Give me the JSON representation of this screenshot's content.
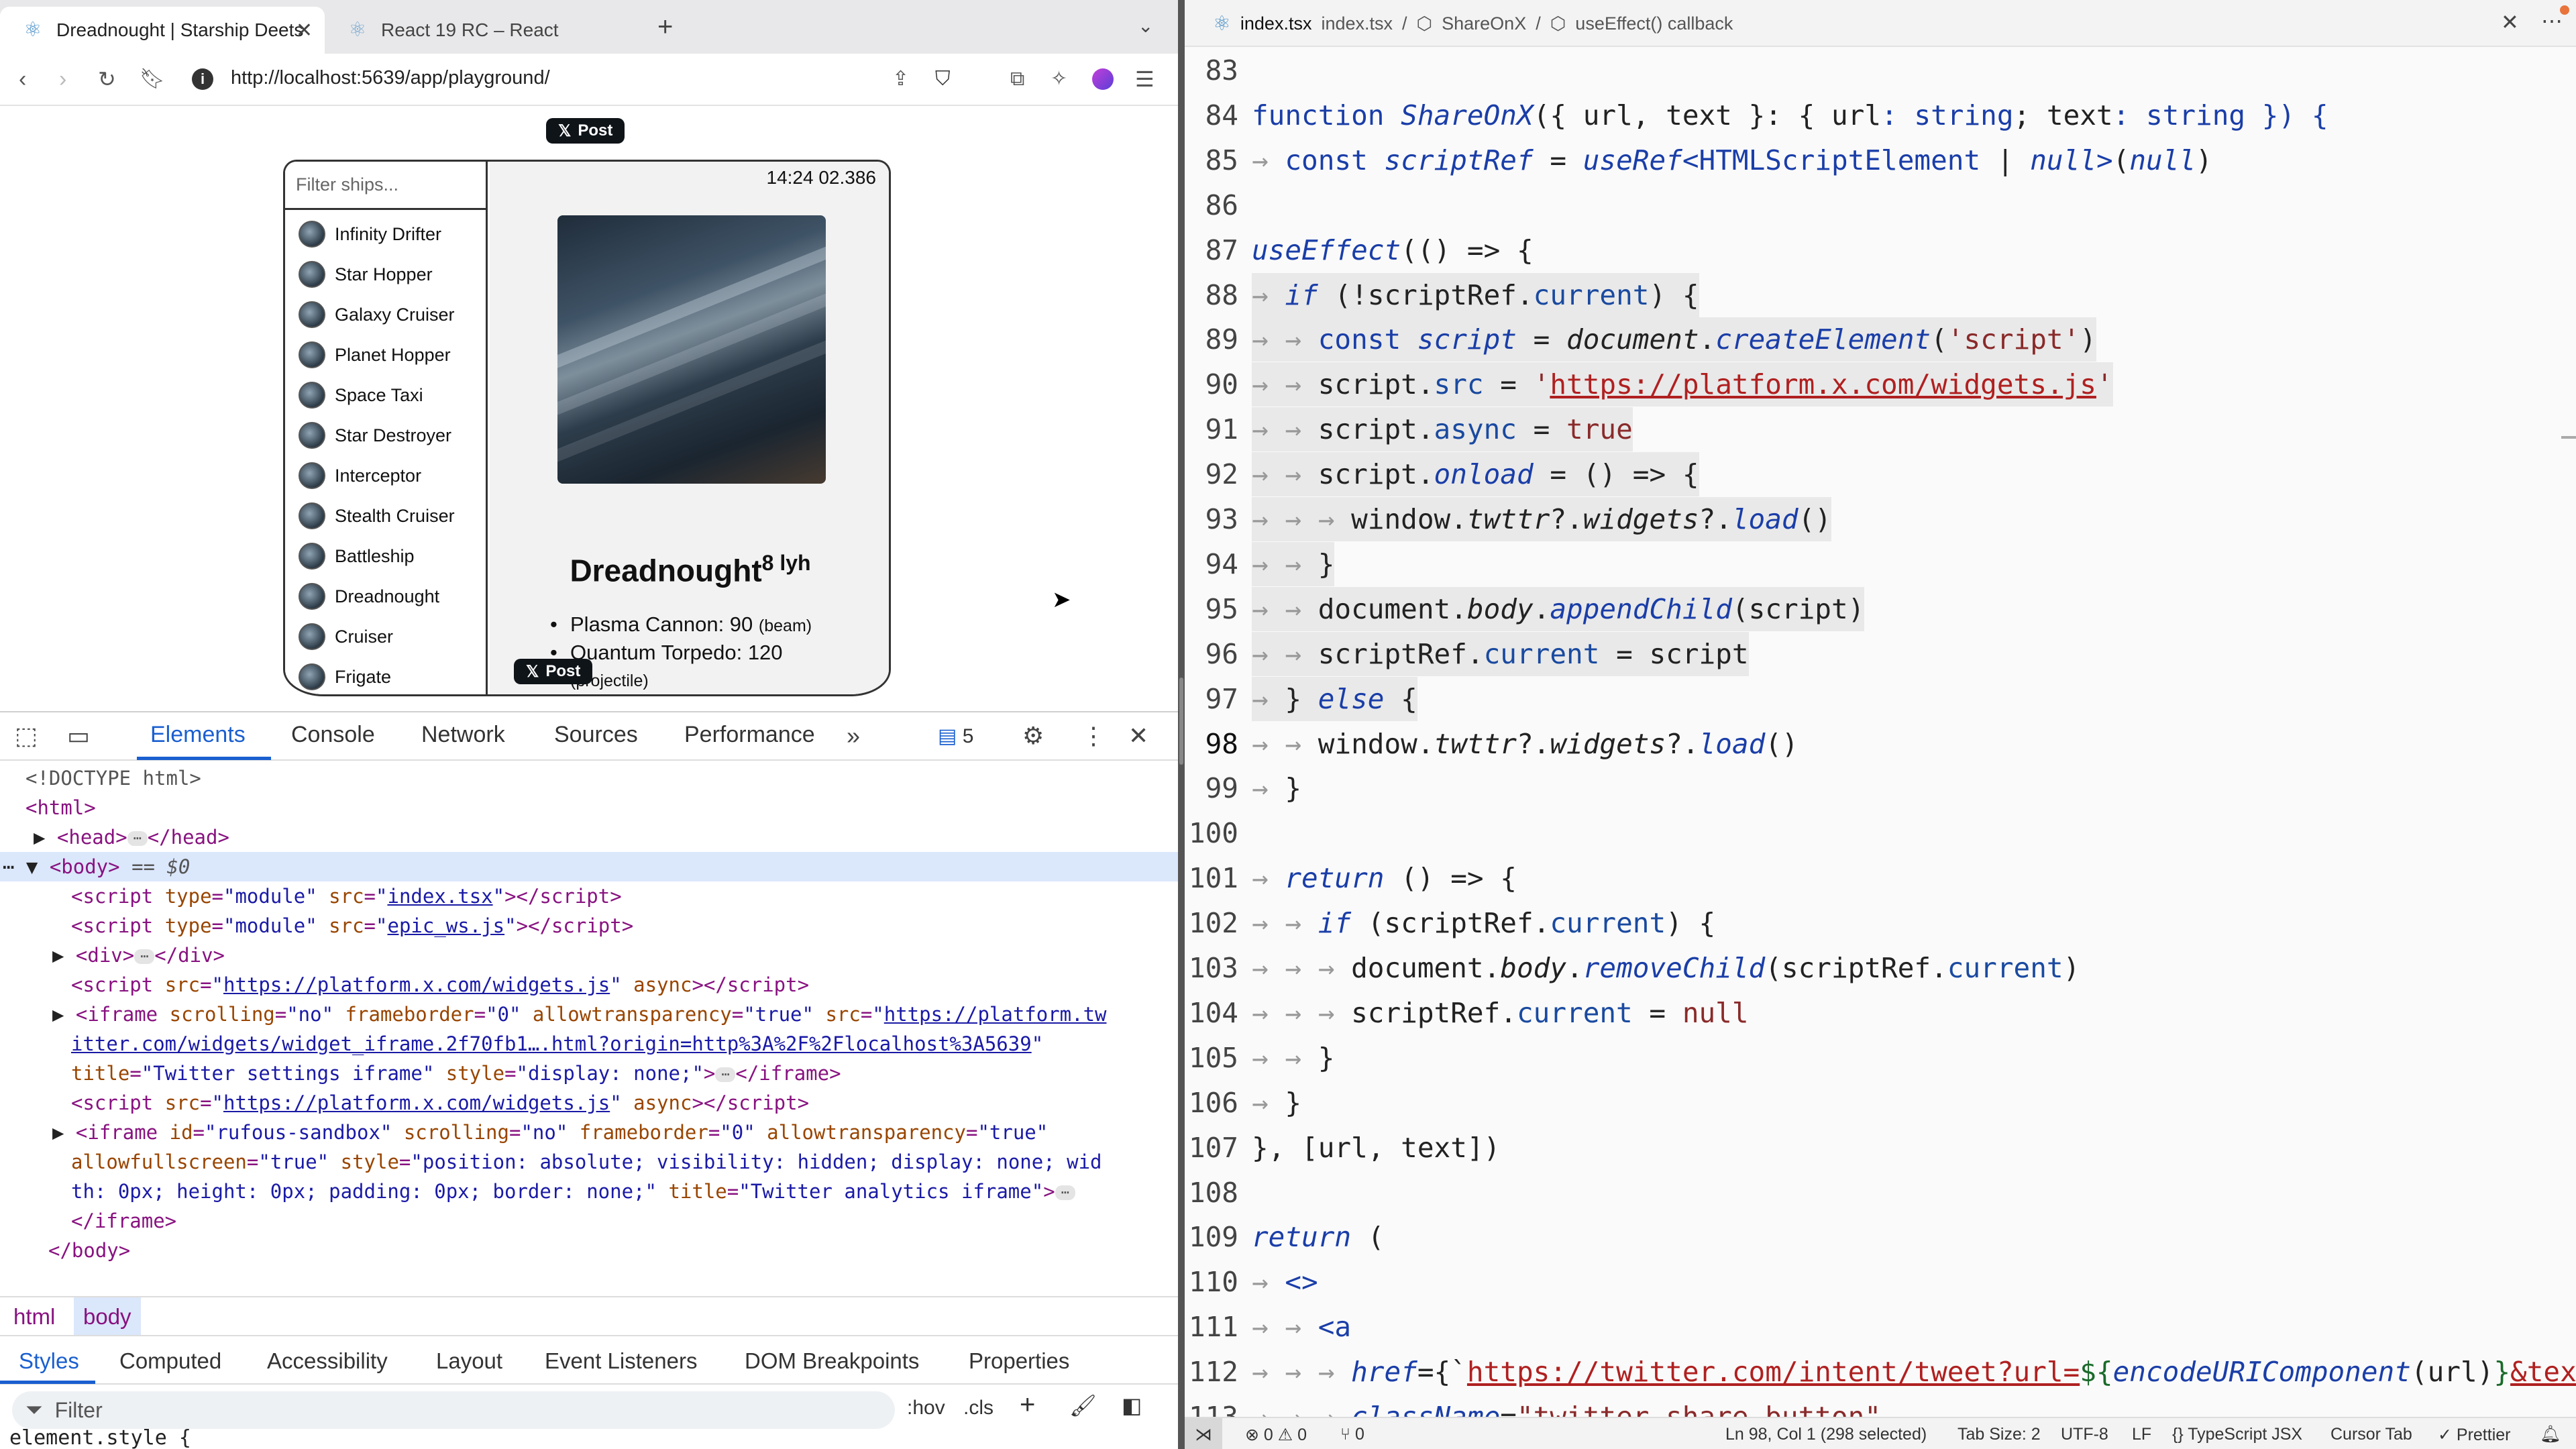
{
  "browser": {
    "tabs": [
      {
        "title": "Dreadnought | Starship Deets",
        "active": true
      },
      {
        "title": "React 19 RC – React",
        "active": false
      }
    ],
    "url": "http://localhost:5639/app/playground/"
  },
  "page": {
    "post_button_label": "Post",
    "filter_placeholder": "Filter ships...",
    "ships": [
      "Infinity Drifter",
      "Star Hopper",
      "Galaxy Cruiser",
      "Planet Hopper",
      "Space Taxi",
      "Star Destroyer",
      "Interceptor",
      "Stealth Cruiser",
      "Battleship",
      "Dreadnought",
      "Cruiser",
      "Frigate"
    ],
    "detail": {
      "time": "14:24 02.386",
      "name": "Dreadnought",
      "speed": "8 lyh",
      "weapons": [
        {
          "name": "Plasma Cannon: 90",
          "type": "(beam)"
        },
        {
          "name": "Quantum Torpedo: 120",
          "type": "(projectile)"
        }
      ]
    }
  },
  "devtools": {
    "tabs": [
      "Elements",
      "Console",
      "Network",
      "Sources",
      "Performance"
    ],
    "issues_count": "5",
    "dom": {
      "doctype": "<!DOCTYPE html>",
      "html_open": "<html>",
      "head": "<head>",
      "head_close": "</head>",
      "body": "<body>",
      "body_marker": "== $0",
      "script1_src": "index.tsx",
      "script2_src": "epic_ws.js",
      "div_open": "<div>",
      "div_close": "</div>",
      "widgets_src": "https://platform.x.com/widgets.js",
      "iframe1_src_a": "https://platform.tw",
      "iframe1_src_b": "itter.com/widgets/widget_iframe.2f70fb1….html?origin=http%3A%2F%2Flocalhost%3A5639",
      "iframe1_title": "Twitter settings iframe",
      "iframe1_style": "display: none;",
      "iframe2_id": "rufous-sandbox",
      "iframe2_style_a": "position: absolute; visibility: hidden; display: none; wid",
      "iframe2_style_b": "th: 0px; height: 0px; padding: 0px; border: none;",
      "iframe2_title": "Twitter analytics iframe",
      "iframe_close": "</iframe>",
      "body_close": "</body>"
    },
    "breadcrumb": [
      "html",
      "body"
    ],
    "subtabs": [
      "Styles",
      "Computed",
      "Accessibility",
      "Layout",
      "Event Listeners",
      "DOM Breakpoints",
      "Properties"
    ],
    "filter_placeholder": "Filter",
    "hov": ":hov",
    "cls": ".cls",
    "element_style": "element.style {"
  },
  "editor": {
    "file": "index.tsx",
    "breadcrumb": [
      "index.tsx",
      "ShareOnX",
      "useEffect() callback"
    ],
    "status": {
      "errors": "0",
      "warnings": "0",
      "ports": "0",
      "position": "Ln 98, Col 1 (298 selected)",
      "tab_size": "Tab Size: 2",
      "encoding": "UTF-8",
      "eol": "LF",
      "language": "TypeScript JSX",
      "cursor_tab": "Cursor Tab",
      "prettier": "Prettier"
    },
    "lines": [
      {
        "n": "83",
        "tokens": []
      },
      {
        "n": "84",
        "tokens": [
          [
            "kw",
            "function "
          ],
          [
            "fn",
            "ShareOnX"
          ],
          [
            "",
            "({ url, text }: { url"
          ],
          [
            "kw",
            ": string"
          ],
          [
            "",
            "; text"
          ],
          [
            "kw",
            ": string"
          ],
          [
            "kw",
            " }) {"
          ]
        ]
      },
      {
        "n": "85",
        "tokens": [
          [
            "ind",
            "→ "
          ],
          [
            "kw",
            "const "
          ],
          [
            "fn",
            "scriptRef"
          ],
          [
            "",
            " = "
          ],
          [
            "fn",
            "useRef"
          ],
          [
            "ty",
            "<HTMLScriptElement"
          ],
          [
            "",
            " | "
          ],
          [
            "kwi",
            "null"
          ],
          [
            "ty",
            ">"
          ],
          [
            "",
            "("
          ],
          [
            "kwi",
            "null"
          ],
          [
            "",
            ")"
          ]
        ]
      },
      {
        "n": "86",
        "tokens": []
      },
      {
        "n": "87",
        "tokens": [
          [
            "fn",
            "useEffect"
          ],
          [
            "",
            "(() => {"
          ]
        ]
      },
      {
        "n": "88",
        "tokens": [
          [
            "ind",
            "→ "
          ],
          [
            "kwi",
            "if"
          ],
          [
            "",
            " (!scriptRef."
          ],
          [
            "prop",
            "current"
          ],
          [
            "",
            ") {"
          ]
        ]
      },
      {
        "n": "89",
        "tokens": [
          [
            "ind",
            "→ → "
          ],
          [
            "kw",
            "const "
          ],
          [
            "fn",
            "script"
          ],
          [
            "",
            " = "
          ],
          [
            "it",
            "document"
          ],
          [
            "",
            "."
          ],
          [
            "fn",
            "createElement"
          ],
          [
            "",
            "("
          ],
          [
            "str",
            "'script'"
          ],
          [
            "",
            ")"
          ]
        ]
      },
      {
        "n": "90",
        "tokens": [
          [
            "ind",
            "→ → "
          ],
          [
            "",
            "script."
          ],
          [
            "prop",
            "src"
          ],
          [
            "",
            " = "
          ],
          [
            "str",
            "'"
          ],
          [
            "url",
            "https://platform.x.com/widgets.js"
          ],
          [
            "str",
            "'"
          ]
        ]
      },
      {
        "n": "91",
        "tokens": [
          [
            "ind",
            "→ → "
          ],
          [
            "",
            "script."
          ],
          [
            "prop",
            "async"
          ],
          [
            "",
            " = "
          ],
          [
            "str",
            "true"
          ]
        ]
      },
      {
        "n": "92",
        "tokens": [
          [
            "ind",
            "→ → "
          ],
          [
            "",
            "script."
          ],
          [
            "fn",
            "onload"
          ],
          [
            "",
            " = () => {"
          ]
        ]
      },
      {
        "n": "93",
        "tokens": [
          [
            "ind",
            "→ → → "
          ],
          [
            "",
            "window."
          ],
          [
            "it",
            "twttr"
          ],
          [
            "",
            "?."
          ],
          [
            "it",
            "widgets"
          ],
          [
            "",
            "?."
          ],
          [
            "fn",
            "load"
          ],
          [
            "",
            "()"
          ]
        ]
      },
      {
        "n": "94",
        "tokens": [
          [
            "ind",
            "→ → "
          ],
          [
            "",
            "}"
          ]
        ]
      },
      {
        "n": "95",
        "tokens": [
          [
            "ind",
            "→ → "
          ],
          [
            "",
            "document."
          ],
          [
            "it",
            "body"
          ],
          [
            "",
            "."
          ],
          [
            "fn",
            "appendChild"
          ],
          [
            "",
            "(script)"
          ]
        ]
      },
      {
        "n": "96",
        "tokens": [
          [
            "ind",
            "→ → "
          ],
          [
            "",
            "scriptRef."
          ],
          [
            "prop",
            "current"
          ],
          [
            "",
            " = script"
          ]
        ]
      },
      {
        "n": "97",
        "tokens": [
          [
            "ind",
            "→ "
          ],
          [
            "",
            "} "
          ],
          [
            "kwi",
            "else"
          ],
          [
            "",
            " {"
          ]
        ]
      },
      {
        "n": "98",
        "tokens": [
          [
            "ind",
            "→ → "
          ],
          [
            "",
            "window."
          ],
          [
            "it",
            "twttr"
          ],
          [
            "",
            "?."
          ],
          [
            "it",
            "widgets"
          ],
          [
            "",
            "?."
          ],
          [
            "fn",
            "load"
          ],
          [
            "",
            "()"
          ]
        ]
      },
      {
        "n": "99",
        "tokens": [
          [
            "ind",
            "→ "
          ],
          [
            "",
            "}"
          ]
        ]
      },
      {
        "n": "100",
        "tokens": []
      },
      {
        "n": "101",
        "tokens": [
          [
            "ind",
            "→ "
          ],
          [
            "kwi",
            "return"
          ],
          [
            "",
            " () => {"
          ]
        ]
      },
      {
        "n": "102",
        "tokens": [
          [
            "ind",
            "→ → "
          ],
          [
            "kwi",
            "if"
          ],
          [
            "",
            " (scriptRef."
          ],
          [
            "prop",
            "current"
          ],
          [
            "",
            ") {"
          ]
        ]
      },
      {
        "n": "103",
        "tokens": [
          [
            "ind",
            "→ → → "
          ],
          [
            "",
            "document."
          ],
          [
            "it",
            "body"
          ],
          [
            "",
            "."
          ],
          [
            "fn",
            "removeChild"
          ],
          [
            "",
            "(scriptRef."
          ],
          [
            "prop",
            "current"
          ],
          [
            "",
            ")"
          ]
        ]
      },
      {
        "n": "104",
        "tokens": [
          [
            "ind",
            "→ → → "
          ],
          [
            "",
            "scriptRef."
          ],
          [
            "prop",
            "current"
          ],
          [
            "",
            " = "
          ],
          [
            "str",
            "null"
          ]
        ]
      },
      {
        "n": "105",
        "tokens": [
          [
            "ind",
            "→ → "
          ],
          [
            "",
            "}"
          ]
        ]
      },
      {
        "n": "106",
        "tokens": [
          [
            "ind",
            "→ "
          ],
          [
            "",
            "}"
          ]
        ]
      },
      {
        "n": "107",
        "tokens": [
          [
            "",
            "}, [url, text])"
          ]
        ]
      },
      {
        "n": "108",
        "tokens": []
      },
      {
        "n": "109",
        "tokens": [
          [
            "kwi",
            "return"
          ],
          [
            "",
            " ("
          ]
        ]
      },
      {
        "n": "110",
        "tokens": [
          [
            "ind",
            "→ "
          ],
          [
            "kw",
            "<>"
          ]
        ]
      },
      {
        "n": "111",
        "tokens": [
          [
            "ind",
            "→ → "
          ],
          [
            "kw",
            "<a"
          ]
        ]
      },
      {
        "n": "112",
        "tokens": [
          [
            "ind",
            "→ → → "
          ],
          [
            "fn",
            "href"
          ],
          [
            "",
            "={`"
          ],
          [
            "url",
            "https://twitter.com/intent/tweet?url="
          ],
          [
            "tpl",
            "${"
          ],
          [
            "fn",
            "encodeURIComponent"
          ],
          [
            "",
            "(url)"
          ],
          [
            "tpl",
            "}"
          ],
          [
            "url",
            "&tex"
          ]
        ]
      },
      {
        "n": "113",
        "tokens": [
          [
            "ind",
            "→ → → "
          ],
          [
            "fn",
            "className"
          ],
          [
            "",
            "="
          ],
          [
            "str",
            "\"twitter-share-button\""
          ]
        ]
      }
    ]
  }
}
